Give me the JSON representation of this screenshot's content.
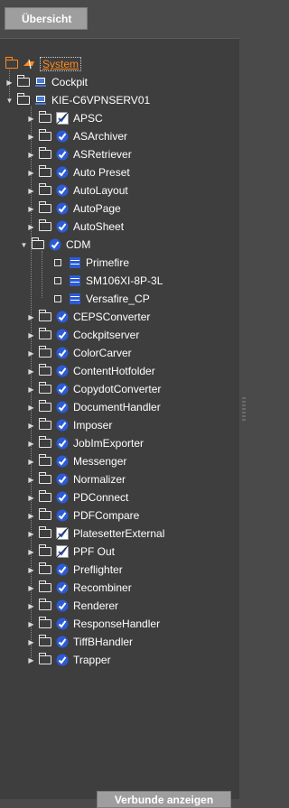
{
  "header": {
    "tab_label": "Übersicht"
  },
  "footer": {
    "button_label": "Verbunde anzeigen"
  },
  "tree": {
    "root": {
      "label": "System"
    },
    "items": [
      {
        "label": "Cockpit",
        "icon": "computer-icon"
      },
      {
        "label": "KIE-C6VPNSERV01",
        "icon": "computer-icon"
      }
    ],
    "services": [
      {
        "label": "APSC",
        "status": "mixed"
      },
      {
        "label": "ASArchiver",
        "status": "checked"
      },
      {
        "label": "ASRetriever",
        "status": "checked"
      },
      {
        "label": "Auto Preset",
        "status": "checked"
      },
      {
        "label": "AutoLayout",
        "status": "checked"
      },
      {
        "label": "AutoPage",
        "status": "checked"
      },
      {
        "label": "AutoSheet",
        "status": "checked"
      },
      {
        "label": "CDM",
        "status": "checked"
      }
    ],
    "cdm_children": [
      {
        "label": "Primefire"
      },
      {
        "label": "SM106XI-8P-3L"
      },
      {
        "label": "Versafire_CP"
      }
    ],
    "services2": [
      {
        "label": "CEPSConverter"
      },
      {
        "label": "Cockpitserver"
      },
      {
        "label": "ColorCarver"
      },
      {
        "label": "ContentHotfolder"
      },
      {
        "label": "CopydotConverter"
      },
      {
        "label": "DocumentHandler"
      },
      {
        "label": "Imposer"
      },
      {
        "label": "JobImExporter"
      },
      {
        "label": "Messenger"
      },
      {
        "label": "Normalizer"
      },
      {
        "label": "PDConnect"
      },
      {
        "label": "PDFCompare"
      },
      {
        "label": "PlatesetterExternal"
      },
      {
        "label": "PPF Out"
      },
      {
        "label": "Preflighter"
      },
      {
        "label": "Recombiner"
      },
      {
        "label": "Renderer"
      },
      {
        "label": "ResponseHandler"
      },
      {
        "label": "TiffBHandler"
      },
      {
        "label": "Trapper"
      }
    ]
  }
}
